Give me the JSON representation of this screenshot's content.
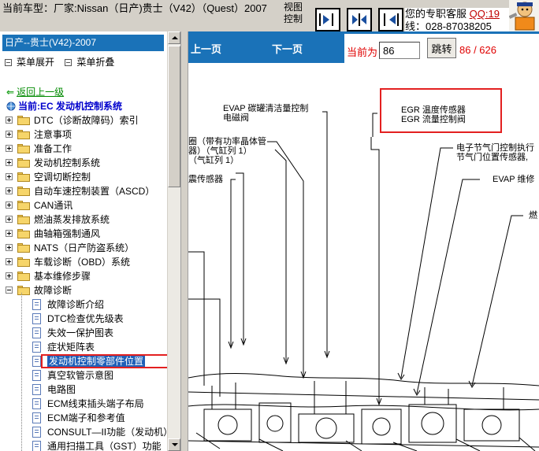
{
  "header": {
    "car_title": "当前车型：厂家:Nissan（日产)贵士（V42）（Quest）2007",
    "view_control": "视图控制",
    "service_text": "您的专职客服",
    "service_qq": "QQ:19",
    "service_phone": "线：028-87038205"
  },
  "tree": {
    "header": "日产--贵士(V42)-2007",
    "expand_all": "菜单展开",
    "collapse_all": "菜单折叠",
    "back": "返回上一级",
    "current": "当前:EC 发动机控制系统",
    "folders": [
      "DTC（诊断故障码）索引",
      "注意事项",
      "准备工作",
      "发动机控制系统",
      "空调切断控制",
      "自动车速控制装置（ASCD）",
      "CAN通讯",
      "燃油蒸发排放系统",
      "曲轴箱强制通风",
      "NATS（日产防盗系统）",
      "车载诊断（OBD）系统",
      "基本维修步骤",
      "故障诊断"
    ],
    "docs": [
      "故障诊断介绍",
      "DTC检查优先级表",
      "失效一保护图表",
      "症状矩阵表",
      "发动机控制零部件位置",
      "真空软管示意图",
      "电路图",
      "ECM线束插头端子布局",
      "ECM端子和参考值",
      "CONSULT—II功能（发动机）",
      "通用扫描工具（GST）功能"
    ]
  },
  "pager": {
    "prev": "上一页",
    "next": "下一页",
    "current_label": "当前为",
    "page_value": "86",
    "jump": "跳转",
    "page_count": "86 / 626"
  },
  "diagram": {
    "evap_canister": "EVAP 碳罐清洁量控制",
    "solenoid_valve": "电磁阀",
    "egr_temp": "EGR 温度传感器",
    "egr_flow": "EGR 流量控制阀",
    "power_transistor": "圈（带有功率晶体管",
    "cyl_a": "器）（气缸列 1）",
    "cyl_b": "（气缸列 1）",
    "etc_actuator": "电子节气门控制执行",
    "tps": "节气门位置传感器,",
    "knock_sensor": "震传感器",
    "evap_service": "EVAP 维修",
    "fuel": "燃"
  },
  "colors": {
    "nav_blue": "#1a72b8",
    "highlight_red": "#e32020",
    "page_red": "#e00000",
    "link_green": "#008a00"
  }
}
